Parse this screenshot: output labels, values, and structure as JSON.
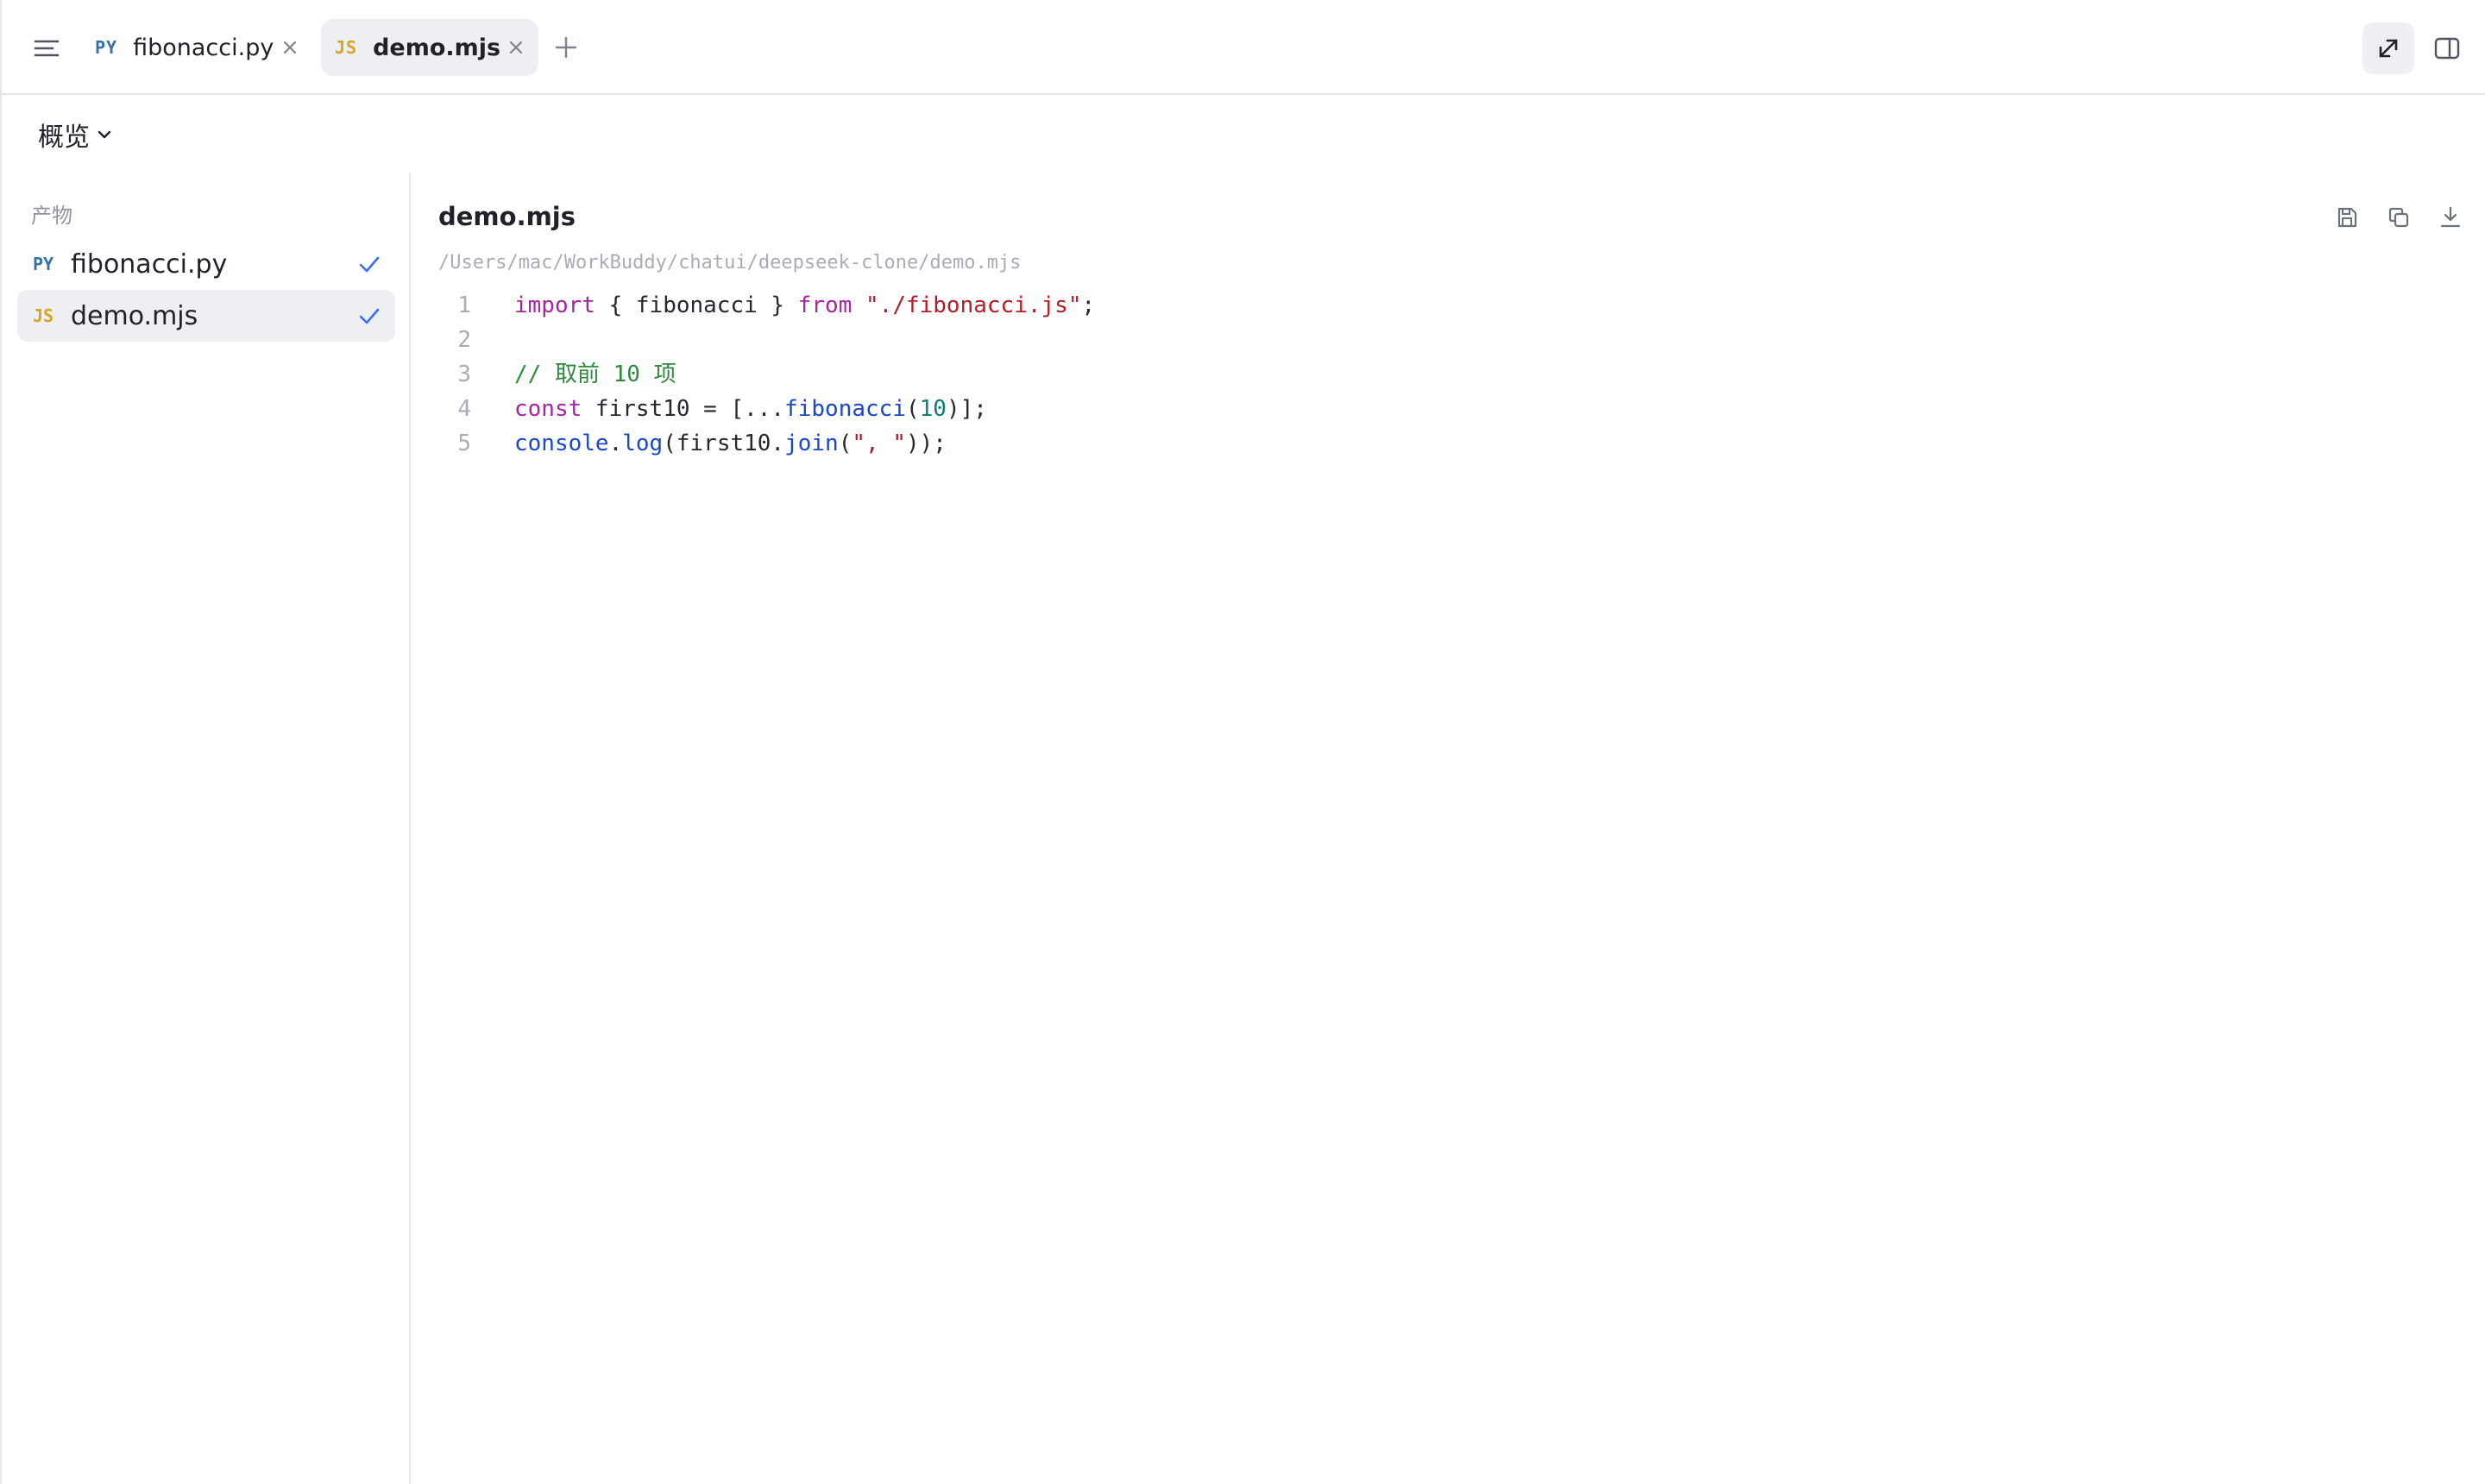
{
  "tabs": [
    {
      "lang": "PY",
      "label": "fibonacci.py",
      "active": false
    },
    {
      "lang": "JS",
      "label": "demo.mjs",
      "active": true
    }
  ],
  "overview": {
    "label": "概览"
  },
  "sidebar": {
    "section_label": "产物",
    "items": [
      {
        "lang": "PY",
        "label": "fibonacci.py",
        "status": "check"
      },
      {
        "lang": "JS",
        "label": "demo.mjs",
        "status": "check",
        "selected": true
      }
    ]
  },
  "document": {
    "title": "demo.mjs",
    "path": "/Users/mac/WorkBuddy/chatui/deepseek-clone/demo.mjs",
    "lines": [
      {
        "no": "1",
        "tokens": [
          {
            "t": "import",
            "k": "kw"
          },
          {
            "t": " { fibonacci } ",
            "k": "plain"
          },
          {
            "t": "from",
            "k": "kw"
          },
          {
            "t": " ",
            "k": "plain"
          },
          {
            "t": "\"./fibonacci.js\"",
            "k": "str"
          },
          {
            "t": ";",
            "k": "plain"
          }
        ]
      },
      {
        "no": "2",
        "tokens": []
      },
      {
        "no": "3",
        "tokens": [
          {
            "t": "// 取前 10 项",
            "k": "cmt"
          }
        ]
      },
      {
        "no": "4",
        "tokens": [
          {
            "t": "const",
            "k": "kw"
          },
          {
            "t": " first10 = [...",
            "k": "plain"
          },
          {
            "t": "fibonacci",
            "k": "fn"
          },
          {
            "t": "(",
            "k": "plain"
          },
          {
            "t": "10",
            "k": "num"
          },
          {
            "t": ")];",
            "k": "plain"
          }
        ]
      },
      {
        "no": "5",
        "tokens": [
          {
            "t": "console",
            "k": "fn"
          },
          {
            "t": ".",
            "k": "plain"
          },
          {
            "t": "log",
            "k": "fn"
          },
          {
            "t": "(first10.",
            "k": "plain"
          },
          {
            "t": "join",
            "k": "fn"
          },
          {
            "t": "(",
            "k": "plain"
          },
          {
            "t": "\", \"",
            "k": "str"
          },
          {
            "t": "));",
            "k": "plain"
          }
        ]
      }
    ]
  },
  "icons": {
    "menu": "menu-icon",
    "close": "close-icon",
    "add": "plus-icon",
    "expand": "expand-icon",
    "panel": "split-panel-icon",
    "chevron": "chevron-down-icon",
    "check": "check-icon",
    "save": "save-icon",
    "copy": "copy-icon",
    "download": "download-icon"
  },
  "colors": {
    "accent": "#3b6ef5",
    "py_badge": "#3571a8",
    "js_badge": "#d9a521",
    "selected_bg": "#eeeff2"
  }
}
